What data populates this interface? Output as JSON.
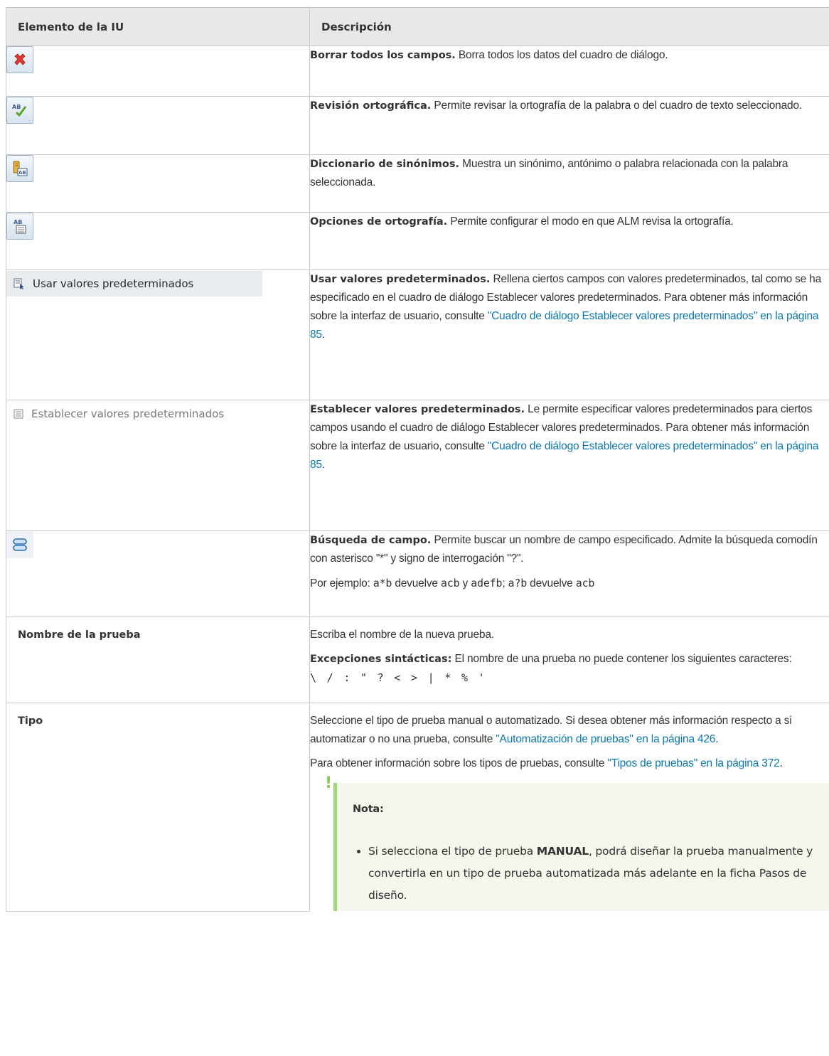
{
  "header": {
    "col1": "Elemento de la IU",
    "col2": "Descripción"
  },
  "rows": [
    {
      "element": {
        "icon": "clear-fields-icon"
      },
      "term": "Borrar todos los campos.",
      "text": " Borra todos los datos del cuadro de diálogo."
    },
    {
      "element": {
        "icon": "spell-check-icon"
      },
      "term": "Revisión ortográfica.",
      "text": " Permite revisar la ortografía de la palabra o del cuadro de texto seleccionado."
    },
    {
      "element": {
        "icon": "thesaurus-icon"
      },
      "term": "Diccionario de sinónimos.",
      "text": " Muestra un sinónimo, antónimo o palabra relacionada con la palabra seleccionada."
    },
    {
      "element": {
        "icon": "spelling-options-icon"
      },
      "term": "Opciones de ortografía.",
      "text": " Permite configurar el modo en que ALM revisa la ortografía."
    },
    {
      "element": {
        "icon": "use-defaults-icon",
        "label": "Usar valores predeterminados"
      },
      "term": "Usar valores predeterminados.",
      "text": " Rellena ciertos campos con valores predeterminados, tal como se ha especificado en el cuadro de diálogo Establecer valores predeterminados. Para obtener más información sobre la interfaz de usuario, consulte ",
      "link": "\"Cuadro de diálogo Establecer valores predeterminados\" en la página 85",
      "after": "."
    },
    {
      "element": {
        "icon": "set-defaults-icon",
        "label": "Establecer valores predeterminados"
      },
      "term": "Establecer valores predeterminados.",
      "text": " Le permite especificar valores predeterminados para ciertos campos usando el cuadro de diálogo Establecer valores predeterminados. Para obtener más información sobre la interfaz de usuario, consulte ",
      "link": "\"Cuadro de diálogo Establecer valores predeterminados\" en la página 85",
      "after": "."
    },
    {
      "element": {
        "icon": "field-search-icon"
      },
      "term": "Búsqueda de campo.",
      "text": " Permite buscar un nombre de campo especificado. Admite la búsqueda comodín con asterisco \"*\" y signo de interrogación \"?\".",
      "example": {
        "p1": "Por ejemplo: ",
        "c1": "a*b",
        "p2": " devuelve ",
        "c2": "acb",
        "p3": " y ",
        "c3": "adefb",
        "p4": "; ",
        "c4": "a?b",
        "p5": " devuelve ",
        "c5": "acb"
      }
    },
    {
      "element": {
        "label": "Nombre de la prueba"
      },
      "text": "Escriba el nombre de la nueva prueba.",
      "term": "Excepciones sintácticas:",
      "text2": " El nombre de una prueba no puede contener los siguientes caracteres: ",
      "chars": "\\ / : \" ? < > | * % '"
    },
    {
      "element": {
        "label": "Tipo"
      },
      "text": "Seleccione el tipo de prueba manual o automatizado. Si desea obtener más información respecto a si automatizar o no una prueba, consulte ",
      "link": "\"Automatización de pruebas\" en la página 426",
      "after": ".",
      "text2": "Para obtener información sobre los tipos de pruebas, consulte ",
      "link2": "\"Tipos de pruebas\" en la página 372",
      "after2": ".",
      "note": {
        "title": "Nota:",
        "bullet_pre": "Si selecciona el tipo de prueba ",
        "bullet_bold": "MANUAL",
        "bullet_post": ", podrá diseñar la prueba manualmente y convertirla en un tipo de prueba automatizada más adelante en la ficha Pasos de diseño."
      }
    }
  ],
  "colors": {
    "link": "#0b77ad",
    "header_bg": "#e8e8e8",
    "note_bar": "#a0d57a",
    "note_bg": "#f4f8ec"
  }
}
